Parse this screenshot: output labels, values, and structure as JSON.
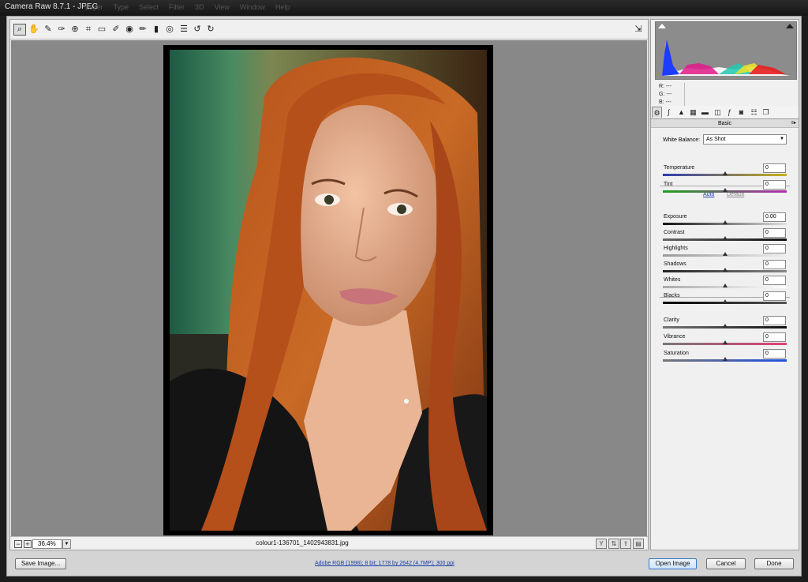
{
  "window": {
    "title": "Camera Raw 8.7.1  -  JPEG",
    "ghost_menu": [
      "Layer",
      "Type",
      "Select",
      "Filter",
      "3D",
      "View",
      "Window",
      "Help"
    ]
  },
  "toolbar": {
    "tools": [
      "zoom-icon",
      "hand-icon",
      "white-balance-icon",
      "color-sampler-icon",
      "targeted-adjustment-icon",
      "crop-icon",
      "straighten-icon",
      "spot-removal-icon",
      "red-eye-icon",
      "adjustment-brush-icon",
      "graduated-filter-icon",
      "radial-filter-icon",
      "preferences-icon",
      "rotate-left-icon",
      "rotate-right-icon"
    ],
    "fullscreen_icon": "fullscreen-icon"
  },
  "preview": {
    "zoom": "36.4%",
    "filename": "colour1-136701_1402943831.jpg"
  },
  "histogram": {
    "r": "R:   ---",
    "g": "G:   ---",
    "b": "B:   ---"
  },
  "panel": {
    "title": "Basic",
    "white_balance_label": "White Balance:",
    "white_balance_value": "As Shot",
    "auto": "Auto",
    "default": "Default",
    "sliders": [
      {
        "label": "Temperature",
        "value": "0",
        "position": 0.5,
        "colors": [
          "#2f3bb0",
          "#c8b21a"
        ]
      },
      {
        "label": "Tint",
        "value": "0",
        "position": 0.5,
        "colors": [
          "#20a020",
          "#b22db0"
        ]
      },
      {
        "label": "Exposure",
        "value": "0.00",
        "position": 0.5,
        "colors": [
          "#111111",
          "#e0e0e0"
        ]
      },
      {
        "label": "Contrast",
        "value": "0",
        "position": 0.5,
        "colors": [
          "#666666",
          "#111111"
        ]
      },
      {
        "label": "Highlights",
        "value": "0",
        "position": 0.5,
        "colors": [
          "#999999",
          "#eeeeee"
        ]
      },
      {
        "label": "Shadows",
        "value": "0",
        "position": 0.5,
        "colors": [
          "#222222",
          "#888888"
        ]
      },
      {
        "label": "Whites",
        "value": "0",
        "position": 0.5,
        "colors": [
          "#aaaaaa",
          "#ffffff"
        ]
      },
      {
        "label": "Blacks",
        "value": "0",
        "position": 0.5,
        "colors": [
          "#000000",
          "#555555"
        ]
      },
      {
        "label": "Clarity",
        "value": "0",
        "position": 0.5,
        "colors": [
          "#777777",
          "#111111"
        ]
      },
      {
        "label": "Vibrance",
        "value": "0",
        "position": 0.5,
        "colors": [
          "#777777",
          "#e0407a"
        ]
      },
      {
        "label": "Saturation",
        "value": "0",
        "position": 0.5,
        "colors": [
          "#777777",
          "#2050e0"
        ]
      }
    ]
  },
  "footer": {
    "save_image": "Save Image...",
    "info": "Adobe RGB (1998); 8 bit; 1778 by 2642 (4.7MP); 300 ppi",
    "open_image": "Open Image",
    "cancel": "Cancel",
    "done": "Done"
  }
}
